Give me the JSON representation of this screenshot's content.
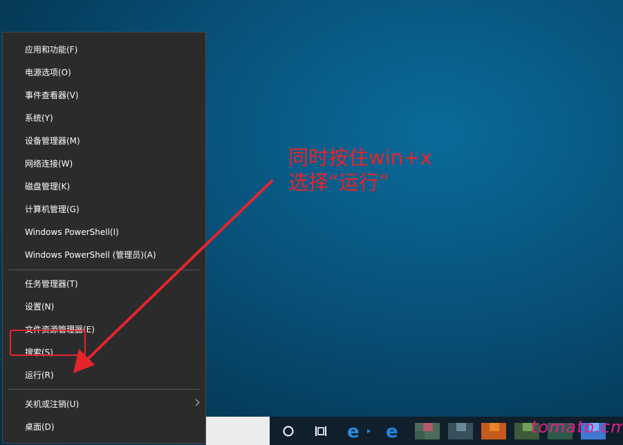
{
  "menu": {
    "items": [
      {
        "label": "应用和功能(F)"
      },
      {
        "label": "电源选项(O)"
      },
      {
        "label": "事件查看器(V)"
      },
      {
        "label": "系统(Y)"
      },
      {
        "label": "设备管理器(M)"
      },
      {
        "label": "网络连接(W)"
      },
      {
        "label": "磁盘管理(K)"
      },
      {
        "label": "计算机管理(G)"
      },
      {
        "label": "Windows PowerShell(I)"
      },
      {
        "label": "Windows PowerShell (管理员)(A)"
      },
      {
        "label": "任务管理器(T)"
      },
      {
        "label": "设置(N)"
      },
      {
        "label": "文件资源管理器(E)"
      },
      {
        "label": "搜索(S)"
      },
      {
        "label": "运行(R)"
      },
      {
        "label": "关机或注销(U)"
      },
      {
        "label": "桌面(D)"
      }
    ]
  },
  "annotation": {
    "line1": "同时按住win+x",
    "line2": "选择“运行”",
    "color": "#e8242b"
  },
  "watermark": "tomato.cm",
  "taskbar": {
    "icons": [
      "cortana-circle-icon",
      "task-view-icon",
      "edge-icon",
      "ie-icon",
      "pinned-app-icons"
    ]
  }
}
